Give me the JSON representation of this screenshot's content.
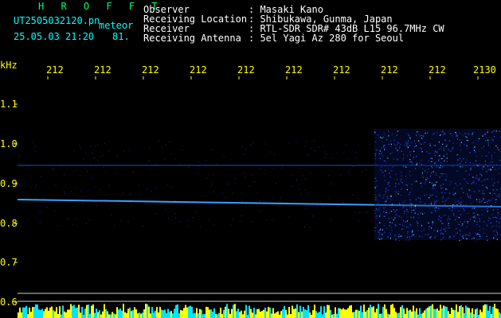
{
  "header": {
    "logo": "H R O F F T",
    "filename": "UT2505032120.pn",
    "tag": "meteor",
    "datetime": "25.05.03 21:20",
    "count": "81.",
    "info_labels": [
      "Observer",
      "Receiving Location",
      "Receiver",
      "Receiving Antenna"
    ],
    "info_values": [
      ": Masaki Kano",
      ": Shibukawa, Gunma, Japan",
      ": RTL-SDR SDR# 43dB L15 96.7MHz CW",
      ": 5el Yagi Az 280 for Seoul"
    ]
  },
  "axis": {
    "y_unit": "kHz",
    "x_ticks": [
      "212",
      "212",
      "212",
      "212",
      "212",
      "212",
      "212",
      "212",
      "212",
      "2130"
    ],
    "y_ticks": [
      "1.1",
      "1.0",
      "0.9",
      "0.8",
      "0.7",
      "0.6"
    ]
  },
  "colors": {
    "background": "#000000",
    "header_text": "#00ffff",
    "logo": "#00ff66",
    "tick_text": "#ffff00",
    "signal": "#3aa0ff",
    "noise_bar": "#ffff00",
    "noise_bar_alt": "#00ffff"
  }
}
